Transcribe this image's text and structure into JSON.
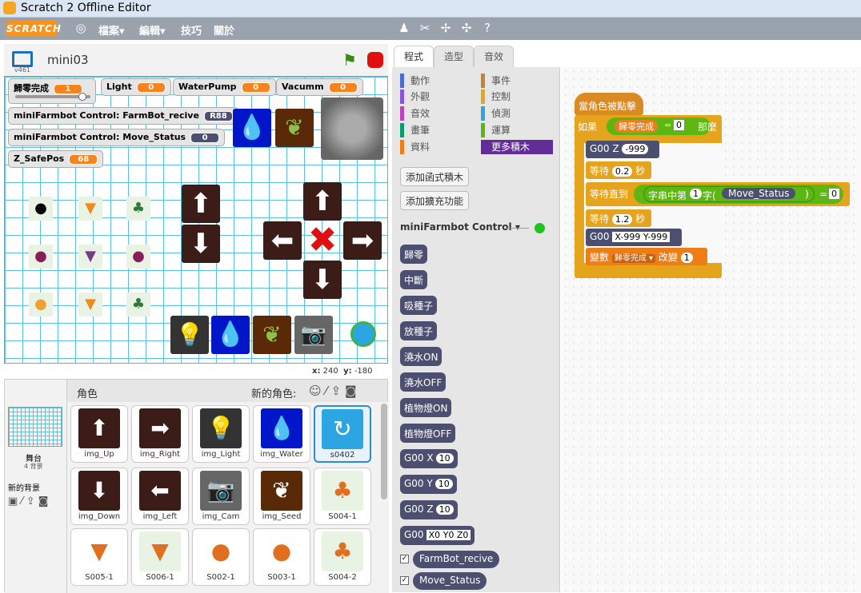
{
  "window": {
    "title": "Scratch 2 Offline Editor"
  },
  "menubar": {
    "logo": "SCRATCH",
    "file": "檔案▾",
    "edit": "編輯▾",
    "tips": "技巧",
    "about": "關於"
  },
  "stage": {
    "project_name": "mini03",
    "version": "v461"
  },
  "monitors": [
    {
      "label": "歸零完成",
      "value": "1"
    },
    {
      "label": "Light",
      "value": "0"
    },
    {
      "label": "WaterPump",
      "value": "0"
    },
    {
      "label": "Vacumm",
      "value": "0"
    },
    {
      "label": "miniFarmbot Control: FarmBot_recive",
      "value": "R88"
    },
    {
      "label": "miniFarmbot Control: Move_Status",
      "value": "0"
    },
    {
      "label": "Z_SafePos",
      "value": "68"
    }
  ],
  "slider": {
    "fraction": 0.9
  },
  "coords": {
    "x_label": "x:",
    "x": "240",
    "y_label": "y:",
    "y": "-180"
  },
  "sprites_panel": {
    "title": "角色",
    "new_sprite": "新的角色:",
    "stage_label": "舞台",
    "backdrops": "4 背景",
    "new_backdrop": "新的背景"
  },
  "sprites": [
    "img_Up",
    "img_Right",
    "img_Light",
    "img_Water",
    "s0402",
    "img_Down",
    "img_Left",
    "img_Cam",
    "img_Seed",
    "S004-1",
    "S005-1",
    "S006-1",
    "S002-1",
    "S003-1",
    "S004-2"
  ],
  "tabs": [
    "程式",
    "造型",
    "音效"
  ],
  "categories": {
    "left": [
      "動作",
      "外觀",
      "音效",
      "畫筆",
      "資料"
    ],
    "right": [
      "事件",
      "控制",
      "偵測",
      "運算",
      "更多積木"
    ]
  },
  "palette": {
    "make_block": "添加函式積木",
    "add_ext": "添加擴充功能",
    "extension": "miniFarmbot Control",
    "blocks": [
      "歸零",
      "中斷",
      "吸種子",
      "放種子",
      "澆水ON",
      "澆水OFF",
      "植物燈ON",
      "植物燈OFF"
    ],
    "g00x": "G00  X",
    "g00x_val": "10",
    "g00y": "G00  Y",
    "g00y_val": "10",
    "g00z": "G00  Z",
    "g00z_val": "10",
    "g00": "G00",
    "g00_val": "X0 Y0 Z0",
    "reporters": [
      "FarmBot_recive",
      "Move_Status"
    ]
  },
  "script": {
    "hat": "當角色被點擊",
    "if": "如果",
    "if_var": "歸零完成",
    "eq": "=",
    "if_val": "0",
    "then": "那麼",
    "g00z": "G00  Z",
    "g00z_val": "-999",
    "wait": "等待",
    "wait1_val": "0.2",
    "sec": "秒",
    "wait_until": "等待直到",
    "str_a": "字串中第",
    "str_n": "1",
    "str_b": "字(",
    "str_var": "Move_Status",
    "str_c": ")",
    "eq2": "=",
    "until_val": "0",
    "wait2_val": "1.2",
    "g00": "G00",
    "g00_val": "X-999 Y-999",
    "change": "變數",
    "change_var": "歸零完成 ▾",
    "change_by": "改變",
    "change_val": "1"
  },
  "colors": {
    "accent": "#f7931e",
    "motion": "#4a6cd4",
    "looks": "#8a55d7",
    "sound": "#bb42c3",
    "pen": "#0e9a6c",
    "data": "#ee7d16",
    "events": "#c88330",
    "control": "#e1a91a",
    "sensing": "#2ca5e2",
    "operators": "#5cb712",
    "more": "#632d99",
    "ext": "#4d4f70"
  }
}
